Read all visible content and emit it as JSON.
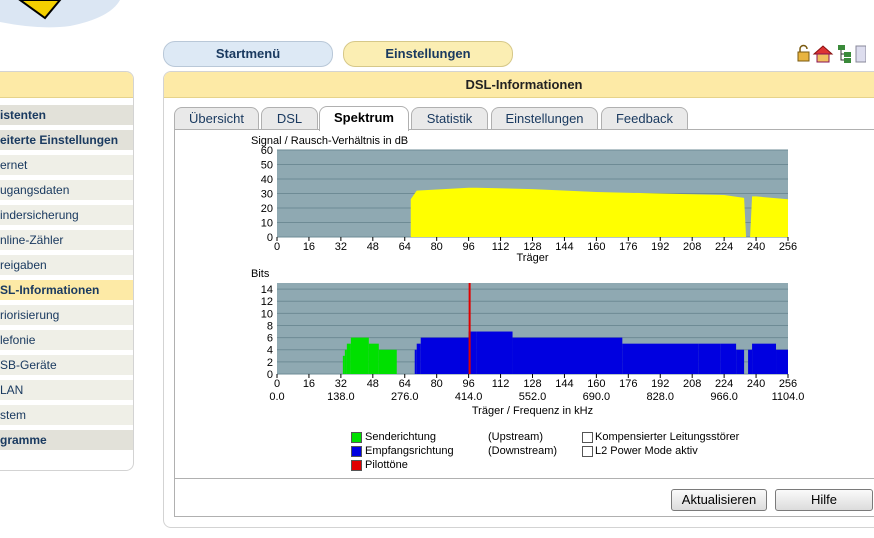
{
  "top_nav": {
    "start_label": "Startmenü",
    "settings_label": "Einstellungen"
  },
  "sidebar": {
    "items": [
      {
        "label": "istenten",
        "level": 0
      },
      {
        "label": "eiterte Einstellungen",
        "level": 0
      },
      {
        "label": "ernet",
        "level": 1
      },
      {
        "label": "ugangsdaten",
        "level": 1
      },
      {
        "label": "indersicherung",
        "level": 1
      },
      {
        "label": "nline-Zähler",
        "level": 1
      },
      {
        "label": "reigaben",
        "level": 1
      },
      {
        "label": "SL-Informationen",
        "level": 1,
        "active": true
      },
      {
        "label": "riorisierung",
        "level": 1
      },
      {
        "label": "lefonie",
        "level": 1
      },
      {
        "label": "SB-Geräte",
        "level": 1
      },
      {
        "label": "LAN",
        "level": 1
      },
      {
        "label": "stem",
        "level": 1
      },
      {
        "label": "gramme",
        "level": 0
      }
    ]
  },
  "panel": {
    "title": "DSL-Informationen",
    "tabs": [
      "Übersicht",
      "DSL",
      "Spektrum",
      "Statistik",
      "Einstellungen",
      "Feedback"
    ],
    "active_tab": "Spektrum"
  },
  "colors": {
    "plot_bg": "#8fa9b2",
    "snr": "#ffff00",
    "upstream": "#00e000",
    "downstream": "#0000e0",
    "pilot": "#e00000"
  },
  "legend": {
    "upstream": "Senderichtung",
    "upstream_paren": "(Upstream)",
    "downstream": "Empfangsrichtung",
    "downstream_paren": "(Downstream)",
    "pilot": "Pilottöne",
    "disturber": "Kompensierter Leitungsstörer",
    "l2": "L2 Power Mode aktiv"
  },
  "buttons": {
    "refresh": "Aktualisieren",
    "help": "Hilfe"
  },
  "chart_data": [
    {
      "type": "area",
      "title": "Signal / Rausch-Verhältnis in dB",
      "xlabel": "Träger",
      "xlim": [
        0,
        256
      ],
      "ylim": [
        0,
        60
      ],
      "yticks": [
        0,
        10,
        20,
        30,
        40,
        50,
        60
      ],
      "xticks": [
        0,
        16,
        32,
        48,
        64,
        80,
        96,
        112,
        128,
        144,
        160,
        176,
        192,
        208,
        224,
        240,
        256
      ],
      "grid": true,
      "series": [
        {
          "segments": [
            {
              "x": [
                67,
                70,
                96,
                100,
                128,
                160,
                192,
                224,
                234,
                235,
                237,
                238,
                240,
                256
              ],
              "y": [
                26,
                32,
                34,
                34,
                33,
                31,
                30,
                29,
                27,
                0,
                0,
                28,
                28,
                26
              ]
            }
          ]
        }
      ]
    },
    {
      "type": "bar",
      "title": "Bits",
      "xlabel": "Träger / Frequenz in kHz",
      "xlim": [
        0,
        256
      ],
      "ylim": [
        0,
        15
      ],
      "yticks": [
        0,
        2,
        4,
        6,
        8,
        10,
        12,
        14
      ],
      "xticks": [
        0,
        16,
        32,
        48,
        64,
        80,
        96,
        112,
        128,
        144,
        160,
        176,
        192,
        208,
        224,
        240,
        256
      ],
      "freq_ticks": [
        "0.0",
        "138.0",
        "276.0",
        "414.0",
        "552.0",
        "690.0",
        "828.0",
        "966.0",
        "1104.0"
      ],
      "grid": true,
      "series": [
        {
          "name": "Senderichtung",
          "steps": [
            [
              33,
              34,
              3
            ],
            [
              34,
              35,
              4
            ],
            [
              35,
              37,
              5
            ],
            [
              37,
              46,
              6
            ],
            [
              46,
              51,
              5
            ],
            [
              51,
              60,
              4
            ]
          ]
        },
        {
          "name": "Empfangsrichtung",
          "steps": [
            [
              69,
              70,
              4
            ],
            [
              70,
              72,
              5
            ],
            [
              72,
              96,
              6
            ],
            [
              96,
              100,
              7
            ],
            [
              100,
              118,
              7
            ],
            [
              118,
              173,
              6
            ],
            [
              173,
              211,
              5
            ],
            [
              211,
              222,
              5
            ],
            [
              222,
              230,
              5
            ],
            [
              230,
              234,
              4
            ],
            [
              236,
              238,
              4
            ],
            [
              238,
              250,
              5
            ],
            [
              250,
              256,
              4
            ]
          ]
        },
        {
          "name": "Pilottöne",
          "steps": [
            [
              96,
              97,
              15
            ]
          ]
        }
      ]
    }
  ]
}
